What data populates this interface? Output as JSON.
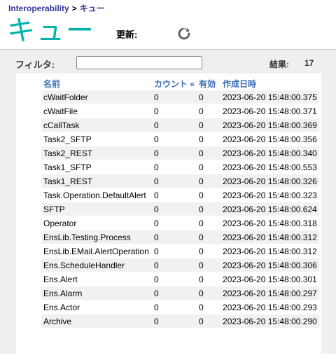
{
  "breadcrumb": {
    "parent": "Interoperability",
    "separator": ">",
    "current": "キュー"
  },
  "page_title": "キュー",
  "refresh_label": "更新:",
  "filter": {
    "label": "フィルタ:",
    "value": ""
  },
  "results": {
    "label": "結果:",
    "count": "17"
  },
  "table": {
    "columns": [
      "名前",
      "カウント «",
      "有効",
      "作成日時"
    ],
    "rows": [
      [
        "cWaitFolder",
        "0",
        "0",
        "2023-06-20 15:48:00.375"
      ],
      [
        "cWaitFile",
        "0",
        "0",
        "2023-06-20 15:48:00.371"
      ],
      [
        "cCallTask",
        "0",
        "0",
        "2023-06-20 15:48:00.369"
      ],
      [
        "Task2_SFTP",
        "0",
        "0",
        "2023-06-20 15:48:00.356"
      ],
      [
        "Task2_REST",
        "0",
        "0",
        "2023-06-20 15:48:00.340"
      ],
      [
        "Task1_SFTP",
        "0",
        "0",
        "2023-06-20 15:48:00.553"
      ],
      [
        "Task1_REST",
        "0",
        "0",
        "2023-06-20 15:48:00.326"
      ],
      [
        "Task.Operation.DefaultAlert",
        "0",
        "0",
        "2023-06-20 15:48:00.323"
      ],
      [
        "SFTP",
        "0",
        "0",
        "2023-06-20 15:48:00.624"
      ],
      [
        "Operator",
        "0",
        "0",
        "2023-06-20 15:48:00.318"
      ],
      [
        "EnsLib.Testing.Process",
        "0",
        "0",
        "2023-06-20 15:48:00.312"
      ],
      [
        "EnsLib.EMail.AlertOperation",
        "0",
        "0",
        "2023-06-20 15:48:00.312"
      ],
      [
        "Ens.ScheduleHandler",
        "0",
        "0",
        "2023-06-20 15:48:00.306"
      ],
      [
        "Ens.Alert",
        "0",
        "0",
        "2023-06-20 15:48:00.301"
      ],
      [
        "Ens.Alarm",
        "0",
        "0",
        "2023-06-20 15:48:00.297"
      ],
      [
        "Ens.Actor",
        "0",
        "0",
        "2023-06-20 15:48:00.293"
      ],
      [
        "Archive",
        "0",
        "0",
        "2023-06-20 15:48:00.290"
      ]
    ]
  },
  "colors": {
    "title": "#00b2a9",
    "header_link": "#3a6db5",
    "breadcrumb": "#333695"
  },
  "icons": {
    "refresh": "refresh-icon"
  }
}
